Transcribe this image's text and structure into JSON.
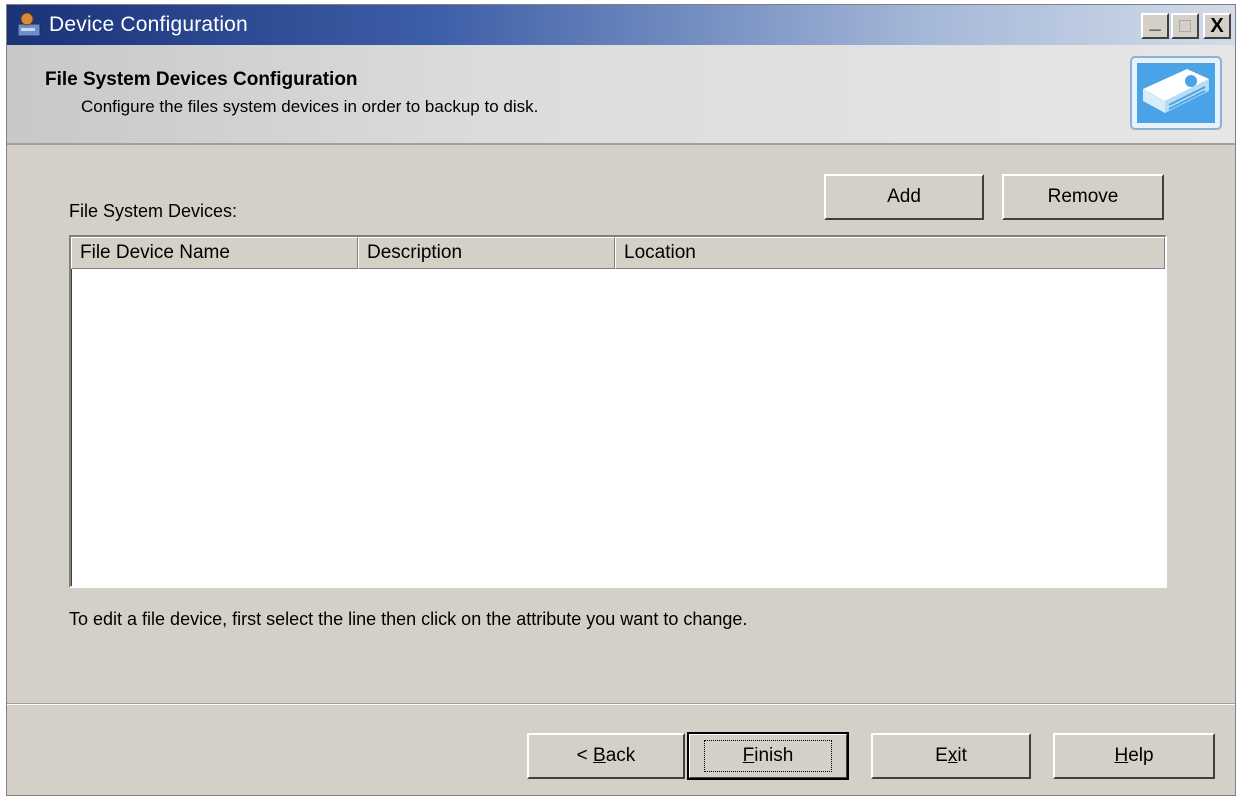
{
  "window": {
    "title": "Device Configuration",
    "controls": {
      "minimize": "_",
      "maximize": "□",
      "close": "X"
    }
  },
  "header": {
    "title": "File System Devices Configuration",
    "subtitle": "Configure the files system devices in order to backup to disk."
  },
  "devices": {
    "label": "File System Devices:",
    "add_label": "Add",
    "remove_label": "Remove",
    "columns": [
      "File Device Name",
      "Description",
      "Location"
    ],
    "rows": [],
    "hint": "To edit a file device, first select the line then click on the attribute you want to change."
  },
  "footer": {
    "back": {
      "prefix": "< ",
      "mnemonic": "B",
      "rest": "ack"
    },
    "finish": {
      "mnemonic": "F",
      "rest": "inish"
    },
    "exit": {
      "pre": "E",
      "mnemonic": "x",
      "rest": "it"
    },
    "help": {
      "mnemonic": "H",
      "rest": "elp"
    }
  },
  "colors": {
    "face": "#d4d0c8",
    "titlebar_start": "#1a3278",
    "titlebar_end": "#d2dbea"
  },
  "icons": {
    "app": "device-config-app-icon",
    "header": "disk-drive-icon"
  }
}
